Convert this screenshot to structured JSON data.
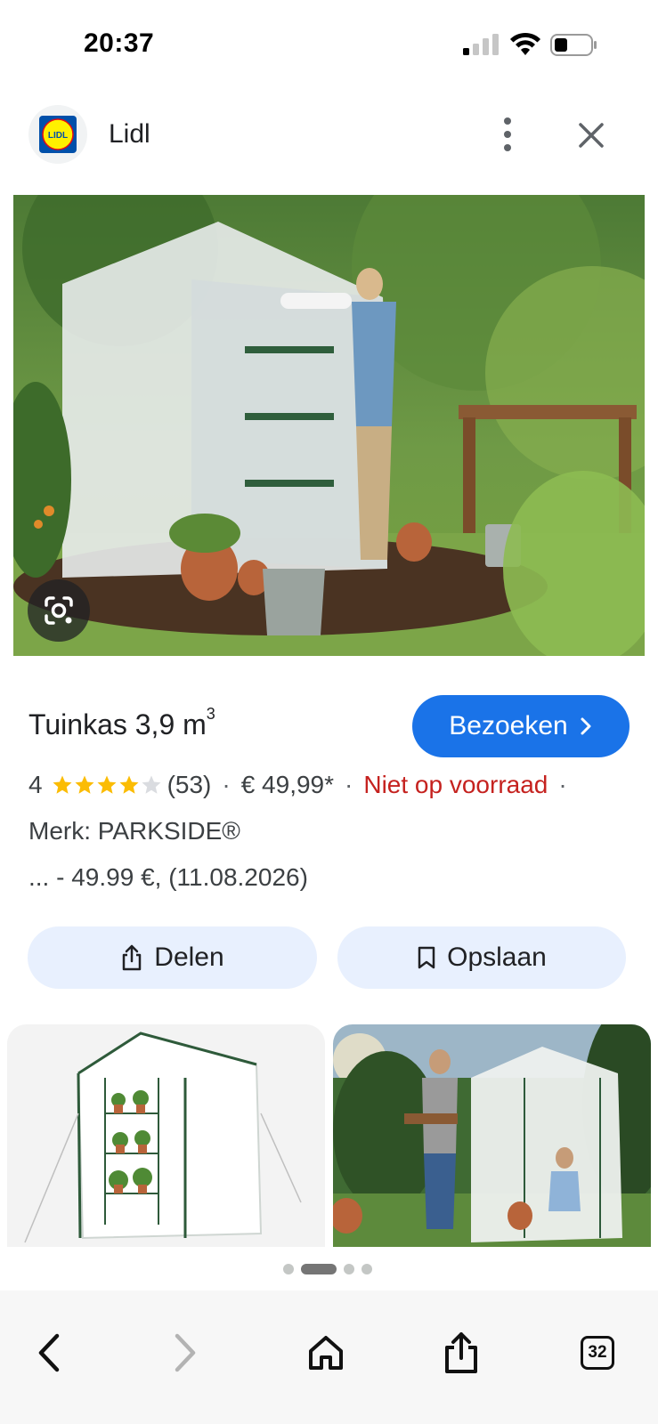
{
  "status_bar": {
    "time": "20:37",
    "icons": [
      "cellular-signal-icon",
      "wifi-icon",
      "battery-icon"
    ]
  },
  "header": {
    "site_name": "Lidl",
    "logo_text": "LIDL",
    "icons": [
      "lidl-logo",
      "more-vert-icon",
      "close-icon"
    ]
  },
  "product": {
    "title": "Tuinkas 3,9 m",
    "title_superscript": "3",
    "rating": "4",
    "stars_filled": 4,
    "stars_total": 5,
    "reviews": "(53)",
    "separator": "·",
    "price": "€ 49,99*",
    "stock": "Niet op voorraad",
    "brand": "Merk: PARKSIDE®",
    "price_snippet": "... - 49.99 €, (11.08.2026)"
  },
  "buttons": {
    "visit": "Bezoeken",
    "share": "Delen",
    "save": "Opslaan"
  },
  "pager": {
    "count": 4,
    "active_index": 1
  },
  "bottom_bar": {
    "tabs_count": "32",
    "icons": [
      "back-icon",
      "forward-icon",
      "home-icon",
      "share-icon",
      "tabs-icon"
    ]
  },
  "colors": {
    "accent": "#1a73e8",
    "stock_red": "#c5221f",
    "star_yellow": "#fbbc04",
    "button_bg": "#e8f0fe"
  }
}
